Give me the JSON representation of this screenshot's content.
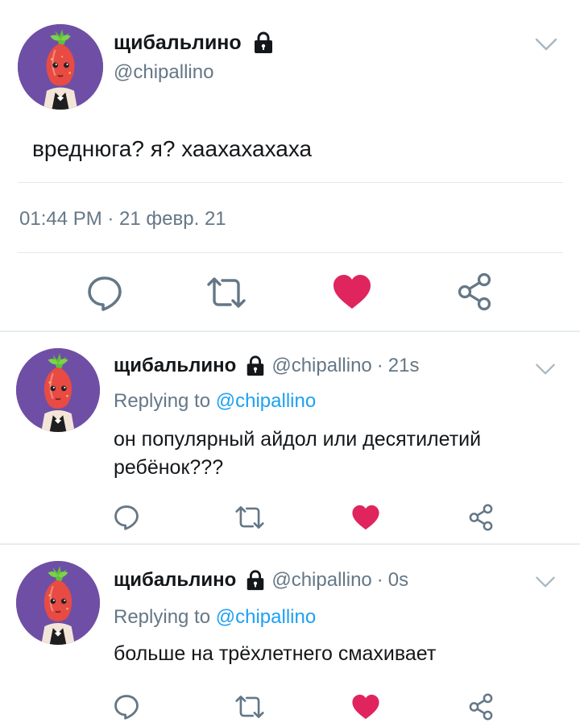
{
  "colors": {
    "text_primary": "#14171a",
    "text_secondary": "#657786",
    "link": "#1da1f2",
    "like": "#e0245e",
    "divider": "#e1e8ed",
    "avatar_background": "#6f4fa5"
  },
  "main_tweet": {
    "avatar_icon": "radish-character-avatar",
    "display_name": "щибальлино",
    "protected_icon": "lock-icon",
    "handle": "@chipallino",
    "menu_icon": "chevron-down-icon",
    "text": "вреднюга? я? хаахахахаха",
    "timestamp": "01:44 PM · 21 февр. 21",
    "actions": {
      "reply_icon": "reply-icon",
      "retweet_icon": "retweet-icon",
      "like_icon": "heart-icon",
      "share_icon": "share-icon"
    }
  },
  "replies": [
    {
      "avatar_icon": "radish-character-avatar",
      "display_name": "щибальлино",
      "protected_icon": "lock-icon",
      "handle": "@chipallino",
      "separator": "·",
      "time": "21s",
      "replying_to_label": "Replying to",
      "replying_to_handle": "@chipallino",
      "text": "он популярный айдол или десятилетий ребёнок???",
      "menu_icon": "chevron-down-icon"
    },
    {
      "avatar_icon": "radish-character-avatar",
      "display_name": "щибальлино",
      "protected_icon": "lock-icon",
      "handle": "@chipallino",
      "separator": "·",
      "time": "0s",
      "replying_to_label": "Replying to",
      "replying_to_handle": "@chipallino",
      "text": "больше на трёхлетнего смахивает",
      "menu_icon": "chevron-down-icon"
    }
  ]
}
